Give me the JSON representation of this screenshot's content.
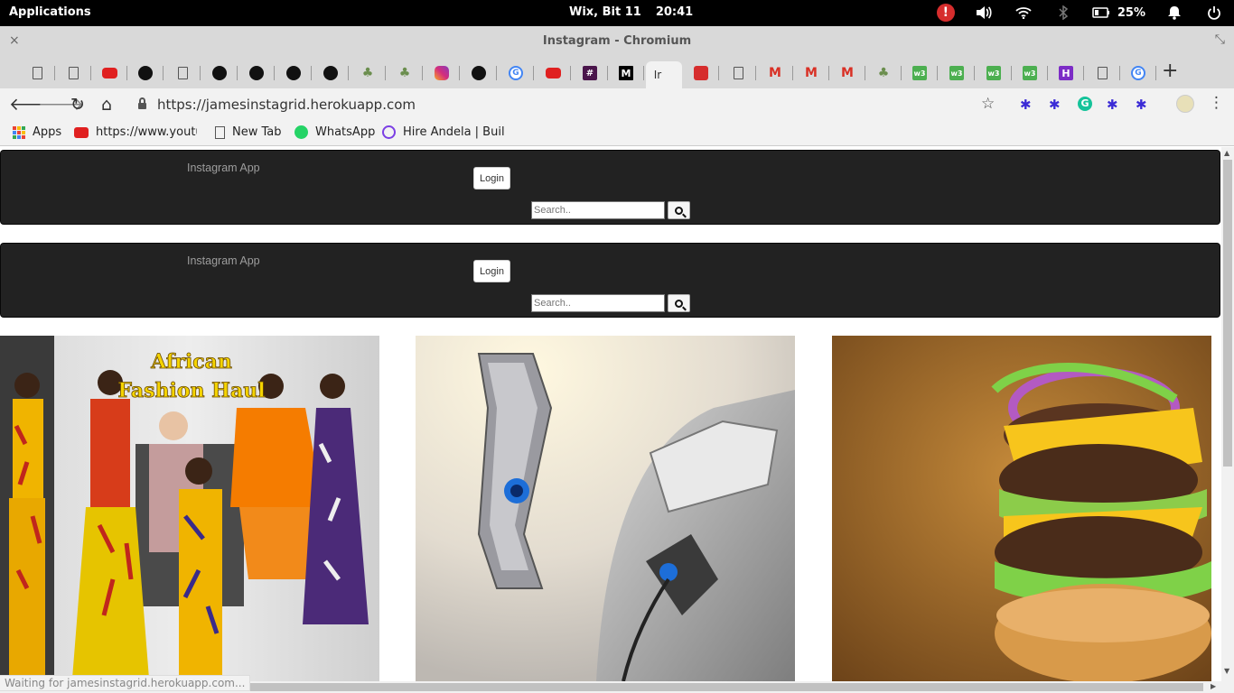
{
  "system_panel": {
    "apps_label": "Applications",
    "date": "Wix, Bit 11",
    "time": "20:41",
    "battery": "25%",
    "alert_glyph": "!"
  },
  "window": {
    "title": "Instagram - Chromium",
    "close_glyph": "×",
    "maximize_glyph": "⤡"
  },
  "tabs": [
    {
      "icon": "doc-icon"
    },
    {
      "icon": "doc-icon"
    },
    {
      "icon": "youtube-icon"
    },
    {
      "icon": "github-icon"
    },
    {
      "icon": "doc-icon"
    },
    {
      "icon": "github-icon"
    },
    {
      "icon": "github-icon"
    },
    {
      "icon": "github-icon"
    },
    {
      "icon": "github-icon"
    },
    {
      "icon": "tree-icon"
    },
    {
      "icon": "tree-icon"
    },
    {
      "icon": "instagram-icon"
    },
    {
      "icon": "github-icon"
    },
    {
      "icon": "google-icon"
    },
    {
      "icon": "youtube-icon"
    },
    {
      "icon": "slack-icon"
    },
    {
      "icon": "medium-icon"
    },
    {
      "icon": "instagram-tab-active",
      "label": "Ir"
    },
    {
      "icon": "red-app-icon"
    },
    {
      "icon": "doc-icon"
    },
    {
      "icon": "gmail-icon"
    },
    {
      "icon": "gmail-icon"
    },
    {
      "icon": "gmail-icon"
    },
    {
      "icon": "tree-icon"
    },
    {
      "icon": "w3-icon"
    },
    {
      "icon": "w3-icon"
    },
    {
      "icon": "w3-icon"
    },
    {
      "icon": "w3-icon"
    },
    {
      "icon": "h-icon"
    },
    {
      "icon": "doc-icon"
    },
    {
      "icon": "google-icon"
    }
  ],
  "active_tab_label": "Ir",
  "tab_close_glyph": "✕",
  "new_tab_glyph": "+",
  "toolbar": {
    "url": "https://jamesinstagrid.herokuapp.com",
    "back_glyph": "🡐",
    "forward_glyph": "🡒",
    "reload_glyph": "↻",
    "home_glyph": "⌂",
    "star_glyph": "☆",
    "menu_glyph": "⋮",
    "grammarly_glyph": "G",
    "extension_glyph": "✱"
  },
  "bookmarks": [
    {
      "label": "Apps",
      "icon": "apps-grid-icon"
    },
    {
      "label": "https://www.youtube",
      "icon": "youtube-icon"
    },
    {
      "label": "New Tab",
      "icon": "doc-icon"
    },
    {
      "label": "WhatsApp",
      "icon": "whatsapp-icon"
    },
    {
      "label": "Hire Andela | Build",
      "icon": "andela-icon"
    }
  ],
  "navbars": [
    {
      "brand": "Instagram App",
      "login": "Login",
      "search_placeholder": "Search.."
    },
    {
      "brand": "Instagram App",
      "login": "Login",
      "search_placeholder": "Search.."
    }
  ],
  "photos": {
    "photo1_title_line1": "African",
    "photo1_title_line2": "Fashion Haul"
  },
  "status_bar": "Waiting for jamesinstagrid.herokuapp.com...",
  "colors": {
    "navbar_bg": "#222222",
    "brand_text": "#9d9d9d",
    "panel_bg": "#000000",
    "chrome_bg": "#d9d9d9"
  }
}
